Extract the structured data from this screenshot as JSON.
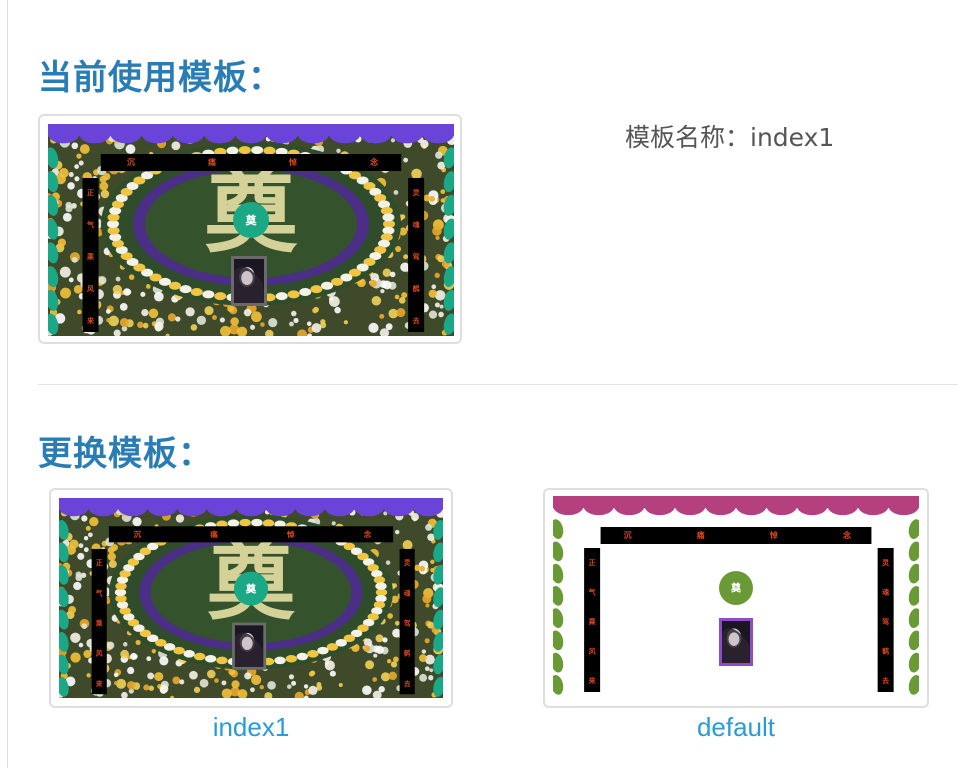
{
  "current": {
    "heading": "当前使用模板：",
    "name_label": "模板名称：",
    "name_value": "index1"
  },
  "change": {
    "heading": "更换模板：",
    "templates": [
      {
        "caption": "index1"
      },
      {
        "caption": "default"
      }
    ]
  },
  "banner": {
    "top": [
      "沉",
      "痛",
      "悼",
      "念"
    ],
    "left": [
      "正",
      "气",
      "乘",
      "风",
      "来"
    ],
    "right": [
      "灵",
      "魂",
      "驾",
      "鹤",
      "去"
    ],
    "center": "奠",
    "big_char": "奠"
  },
  "colors": {
    "heading": "#2a7cb5",
    "link": "#2a9bd8",
    "scallop_purple": "#6a44d8",
    "leaf_teal": "#1aa886",
    "scallop_magenta": "#b4407f",
    "leaf_green": "#6a9a36",
    "banner_text": "#d9491c"
  }
}
